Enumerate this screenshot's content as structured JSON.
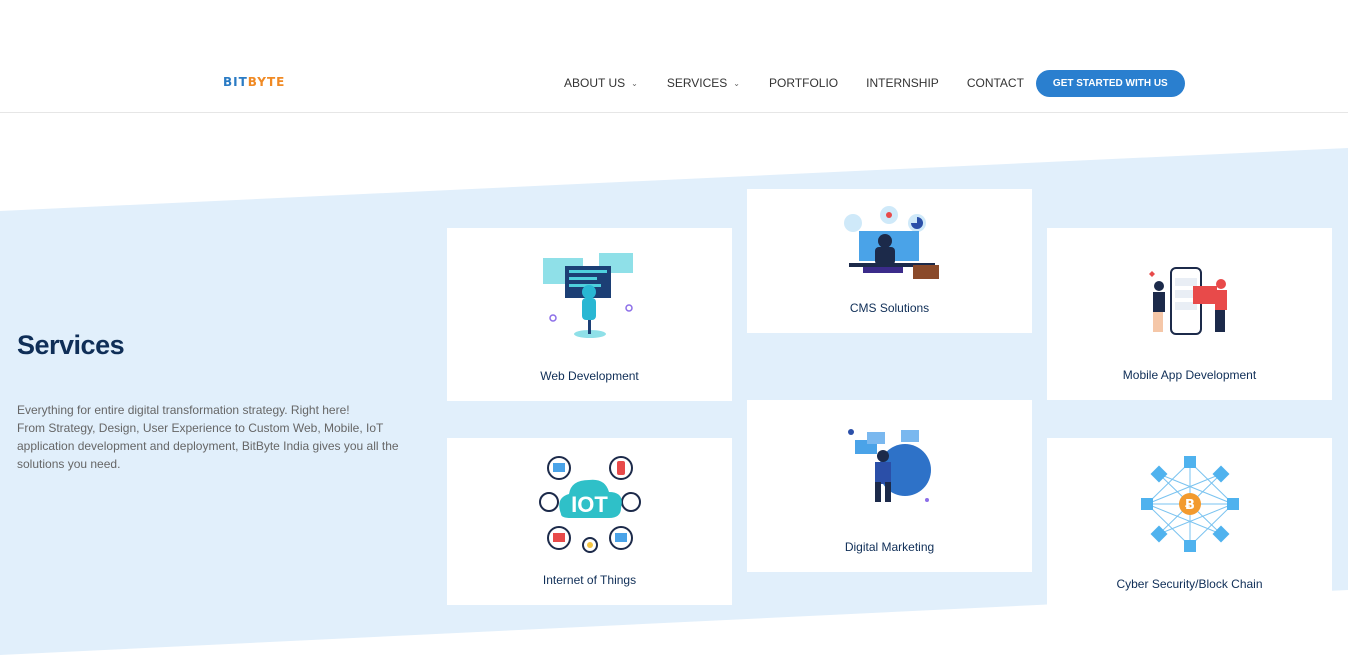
{
  "header": {
    "logo": {
      "part1": "BIT",
      "part2": "BYTE"
    },
    "nav": [
      {
        "label": "ABOUT US",
        "dropdown": true
      },
      {
        "label": "SERVICES",
        "dropdown": true
      },
      {
        "label": "PORTFOLIO",
        "dropdown": false
      },
      {
        "label": "INTERNSHIP",
        "dropdown": false
      },
      {
        "label": "CONTACT",
        "dropdown": false
      }
    ],
    "cta_label": "GET STARTED WITH US"
  },
  "services": {
    "title": "Services",
    "description": "Everything for entire digital transformation strategy. Right here!\nFrom Strategy, Design, User Experience to Custom Web, Mobile, IoT application development and deployment, BitByte India gives you all the solutions you need.",
    "cards": [
      {
        "label": "Web Development",
        "icon": "web-development-icon"
      },
      {
        "label": "CMS Solutions",
        "icon": "cms-icon"
      },
      {
        "label": "Mobile App Development",
        "icon": "mobile-app-icon"
      },
      {
        "label": "Internet of Things",
        "icon": "iot-icon"
      },
      {
        "label": "Digital Marketing",
        "icon": "digital-marketing-icon"
      },
      {
        "label": "Cyber Security/Block Chain",
        "icon": "blockchain-icon"
      }
    ],
    "iot_badge": "IOT"
  },
  "colors": {
    "accent": "#2a7fcf",
    "heading": "#0f2e57",
    "band": "#e1effb",
    "logo_blue": "#2a7bc4",
    "logo_orange": "#f08a24"
  }
}
